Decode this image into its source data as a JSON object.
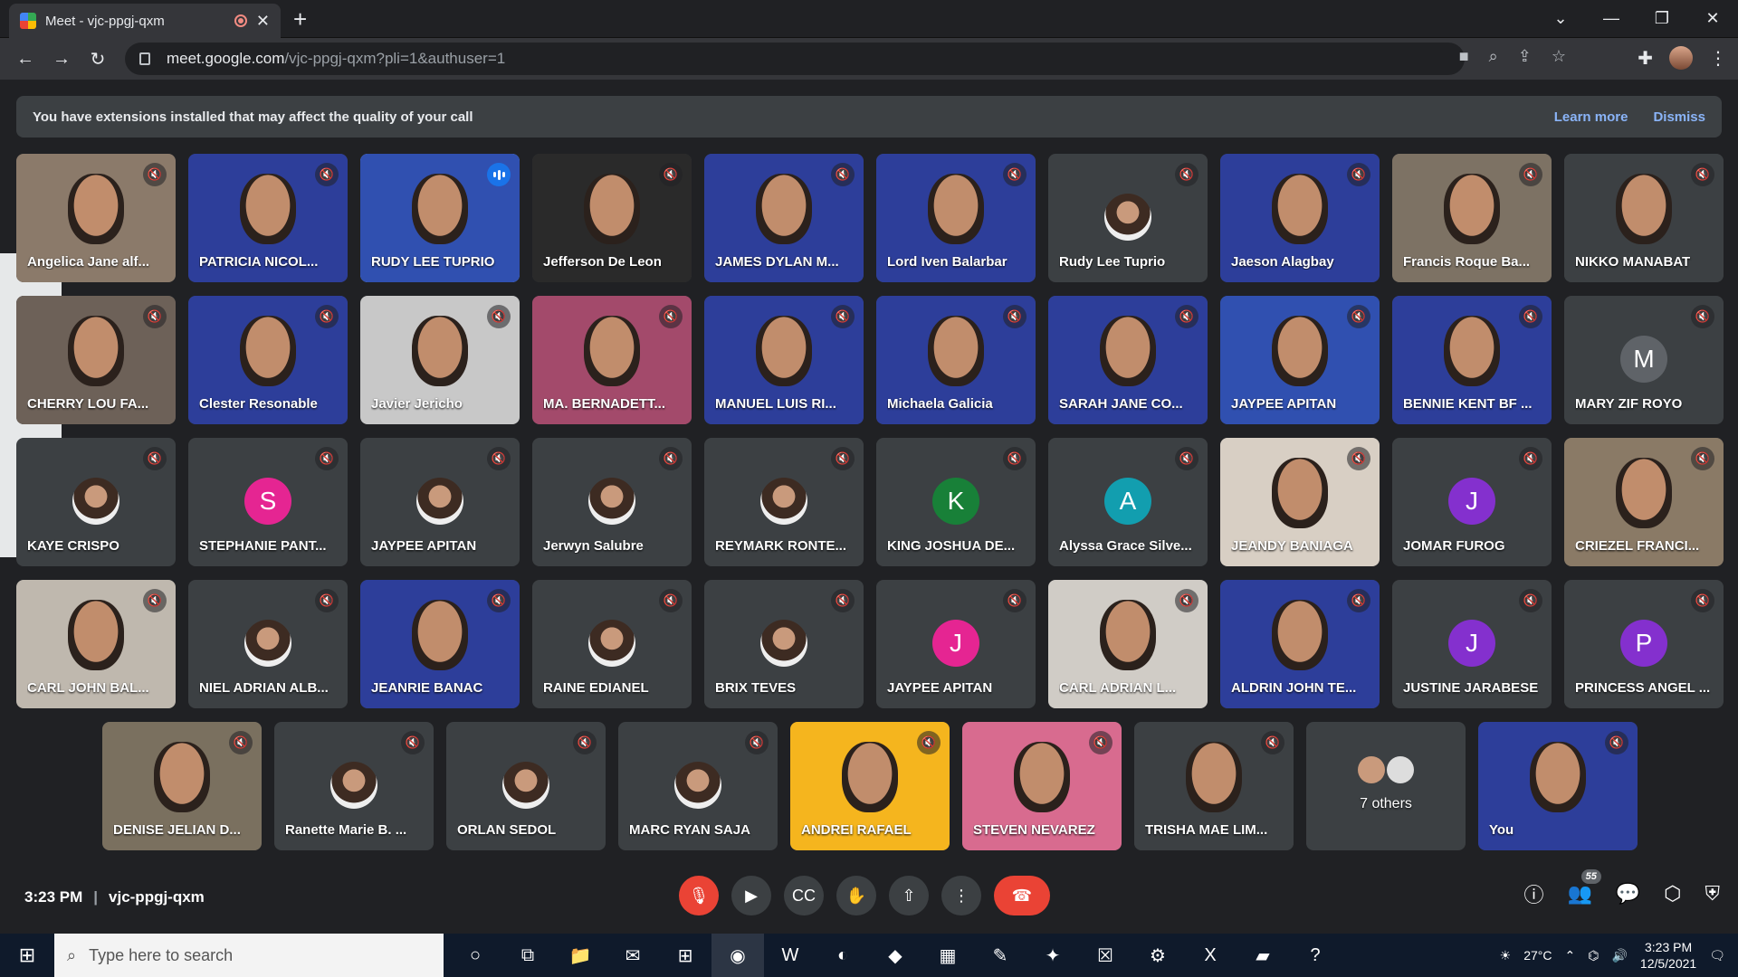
{
  "browser": {
    "tab_title": "Meet - vjc-ppgj-qxm",
    "url_host": "meet.google.com",
    "url_path": "/vjc-ppgj-qxm?pli=1&authuser=1"
  },
  "banner": {
    "message": "You have extensions installed that may affect the quality of your call",
    "learn_more": "Learn more",
    "dismiss": "Dismiss"
  },
  "participants": [
    {
      "name": "Angelica Jane alf...",
      "kind": "video",
      "bg": "#8b7a6a"
    },
    {
      "name": "PATRICIA NICOL...",
      "kind": "video",
      "bg": "#2d3e9a"
    },
    {
      "name": "RUDY LEE TUPRIO",
      "kind": "video",
      "bg": "#3050b0",
      "active": true
    },
    {
      "name": "Jefferson De Leon",
      "kind": "video",
      "bg": "#2a2a2a"
    },
    {
      "name": "JAMES DYLAN M...",
      "kind": "video",
      "bg": "#2d3e9a"
    },
    {
      "name": "Lord Iven Balarbar",
      "kind": "video",
      "bg": "#2d3e9a"
    },
    {
      "name": "Rudy Lee Tuprio",
      "kind": "photo"
    },
    {
      "name": "Jaeson Alagbay",
      "kind": "video",
      "bg": "#2d3e9a"
    },
    {
      "name": "Francis Roque Ba...",
      "kind": "video",
      "bg": "#7d7264"
    },
    {
      "name": "NIKKO MANABAT",
      "kind": "video",
      "bg": "#3c4043"
    },
    {
      "name": "CHERRY LOU FA...",
      "kind": "video",
      "bg": "#6d6158"
    },
    {
      "name": "Clester Resonable",
      "kind": "video",
      "bg": "#2d3e9a"
    },
    {
      "name": "Javier Jericho",
      "kind": "video",
      "bg": "#c8c8c8"
    },
    {
      "name": "MA. BERNADETT...",
      "kind": "video",
      "bg": "#a34a6b"
    },
    {
      "name": "MANUEL LUIS RI...",
      "kind": "video",
      "bg": "#2d3e9a"
    },
    {
      "name": "Michaela Galicia",
      "kind": "video",
      "bg": "#2d3e9a"
    },
    {
      "name": "SARAH JANE CO...",
      "kind": "video",
      "bg": "#2d3e9a"
    },
    {
      "name": "JAYPEE APITAN",
      "kind": "video",
      "bg": "#3050b0"
    },
    {
      "name": "BENNIE KENT BF ...",
      "kind": "video",
      "bg": "#2d3e9a"
    },
    {
      "name": "MARY ZIF ROYO",
      "kind": "letter",
      "letter": "M",
      "color": "#5f6368"
    },
    {
      "name": "KAYE CRISPO",
      "kind": "photo"
    },
    {
      "name": "STEPHANIE PANT...",
      "kind": "letter",
      "letter": "S",
      "color": "#e52592"
    },
    {
      "name": "JAYPEE APITAN",
      "kind": "photo"
    },
    {
      "name": "Jerwyn Salubre",
      "kind": "photo"
    },
    {
      "name": "REYMARK RONTE...",
      "kind": "photo"
    },
    {
      "name": "KING JOSHUA DE...",
      "kind": "letter",
      "letter": "K",
      "color": "#188038"
    },
    {
      "name": "Alyssa Grace Silve...",
      "kind": "letter",
      "letter": "A",
      "color": "#129eaf"
    },
    {
      "name": "JEANDY BANIAGA",
      "kind": "video",
      "bg": "#d8cfc4"
    },
    {
      "name": "JOMAR FUROG",
      "kind": "letter",
      "letter": "J",
      "color": "#8430ce"
    },
    {
      "name": "CRIEZEL FRANCI...",
      "kind": "video",
      "bg": "#8a7a66"
    },
    {
      "name": "CARL JOHN BAL...",
      "kind": "video",
      "bg": "#bfb8ae"
    },
    {
      "name": "NIEL ADRIAN ALB...",
      "kind": "photo"
    },
    {
      "name": "JEANRIE BANAC",
      "kind": "video",
      "bg": "#2d3e9a"
    },
    {
      "name": "RAINE EDIANEL",
      "kind": "photo"
    },
    {
      "name": "BRIX TEVES",
      "kind": "photo"
    },
    {
      "name": "JAYPEE APITAN",
      "kind": "letter",
      "letter": "J",
      "color": "#e52592"
    },
    {
      "name": "CARL ADRIAN L...",
      "kind": "video",
      "bg": "#d0ccc6"
    },
    {
      "name": "ALDRIN JOHN TE...",
      "kind": "video",
      "bg": "#2d3e9a"
    },
    {
      "name": "JUSTINE JARABESE",
      "kind": "letter",
      "letter": "J",
      "color": "#8430ce"
    },
    {
      "name": "PRINCESS ANGEL ...",
      "kind": "letter",
      "letter": "P",
      "color": "#8430ce"
    },
    {
      "name": "DENISE JELIAN D...",
      "kind": "video",
      "bg": "#7a705f"
    },
    {
      "name": "Ranette Marie B. ...",
      "kind": "photo"
    },
    {
      "name": "ORLAN SEDOL",
      "kind": "photo"
    },
    {
      "name": "MARC RYAN SAJA",
      "kind": "photo"
    },
    {
      "name": "ANDREI RAFAEL",
      "kind": "video",
      "bg": "#f5b51e"
    },
    {
      "name": "STEVEN NEVAREZ",
      "kind": "video",
      "bg": "#d86b8f"
    },
    {
      "name": "TRISHA MAE LIM...",
      "kind": "video",
      "bg": "#3c4043"
    },
    {
      "name": "7 others",
      "kind": "others"
    },
    {
      "name": "You",
      "kind": "video",
      "bg": "#2d3e9a"
    }
  ],
  "meeting": {
    "time": "3:23 PM",
    "code": "vjc-ppgj-qxm",
    "participant_count": "55"
  },
  "taskbar": {
    "search_placeholder": "Type here to search",
    "temperature": "27°C",
    "time": "3:23 PM",
    "date": "12/5/2021"
  }
}
